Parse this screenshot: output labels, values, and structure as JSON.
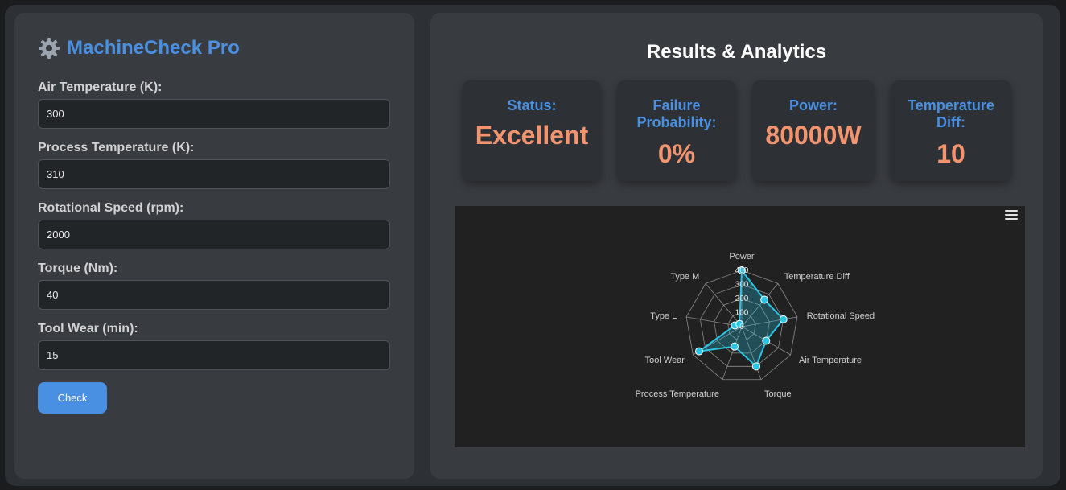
{
  "app": {
    "title": "MachineCheck Pro"
  },
  "form": {
    "fields": [
      {
        "label": "Air Temperature (K):",
        "value": "300"
      },
      {
        "label": "Process Temperature (K):",
        "value": "310"
      },
      {
        "label": "Rotational Speed (rpm):",
        "value": "2000"
      },
      {
        "label": "Torque (Nm):",
        "value": "40"
      },
      {
        "label": "Tool Wear (min):",
        "value": "15"
      }
    ],
    "submit_label": "Check"
  },
  "results": {
    "title": "Results & Analytics",
    "cards": [
      {
        "label": "Status:",
        "value": "Excellent"
      },
      {
        "label": "Failure Probability:",
        "value": "0%"
      },
      {
        "label": "Power:",
        "value": "80000W"
      },
      {
        "label": "Temperature Diff:",
        "value": "10"
      }
    ]
  },
  "colors": {
    "accent": "#4a90e2",
    "value": "#f4946f",
    "series": "#29c5e6"
  },
  "chart_data": {
    "type": "radar",
    "categories": [
      "Power",
      "Temperature Diff",
      "Rotational Speed",
      "Air Temperature",
      "Torque",
      "Process Temperature",
      "Tool Wear",
      "Type L",
      "Type M"
    ],
    "values": [
      400,
      250,
      300,
      200,
      300,
      150,
      350,
      50,
      25
    ],
    "radial_ticks": [
      "0",
      "100",
      "200",
      "300",
      "400"
    ],
    "rmax": 400,
    "grid": true
  }
}
